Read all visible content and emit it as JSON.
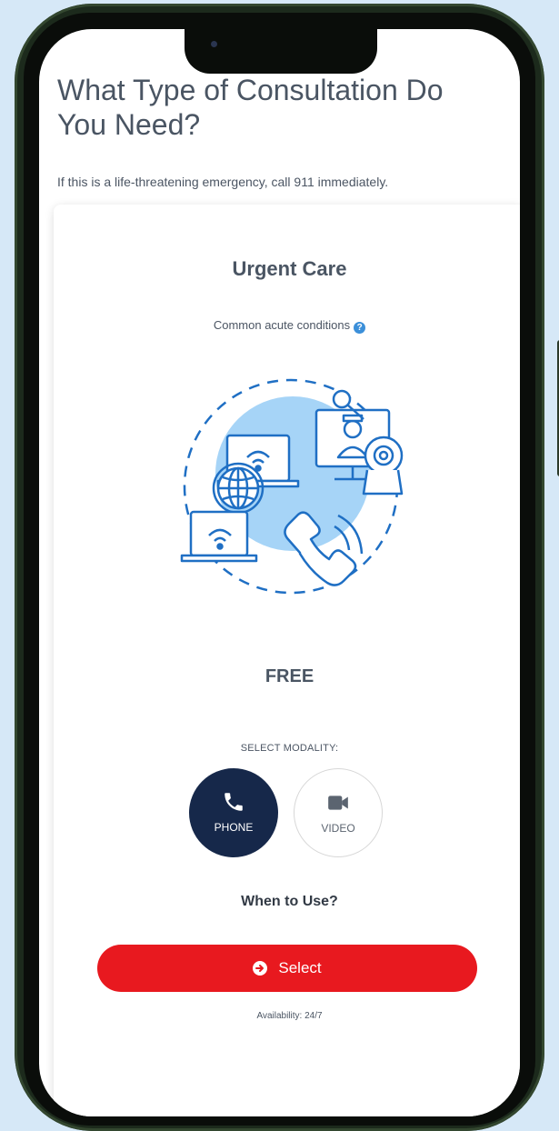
{
  "header": {
    "title": "What Type of Consultation Do You Need?",
    "notice": "If this is a life-threatening emergency, call 911 immediately."
  },
  "card": {
    "title": "Urgent Care",
    "subtitle": "Common acute conditions",
    "help_icon": "question-circle-icon",
    "illustration": "telehealth-illustration",
    "price": "FREE",
    "modality_label": "SELECT MODALITY:",
    "modalities": [
      {
        "label": "PHONE",
        "icon": "phone-icon",
        "selected": true
      },
      {
        "label": "VIDEO",
        "icon": "video-camera-icon",
        "selected": false
      }
    ],
    "when_to_use": "When to Use?",
    "select_label": "Select",
    "availability": "Availability: 24/7"
  },
  "colors": {
    "accent_red": "#e8191f",
    "selected_navy": "#16284a",
    "illustration_blue": "#1f6fc4",
    "illustration_light": "#a6d4f7",
    "background": "#d6e8f7"
  }
}
